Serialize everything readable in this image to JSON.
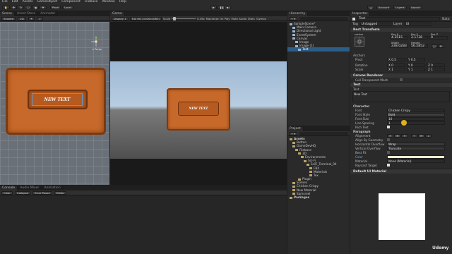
{
  "menu": [
    "File",
    "Edit",
    "Assets",
    "GameObject",
    "Component",
    "Filebase",
    "Window",
    "Help"
  ],
  "top_right": {
    "account": "Account",
    "layers": "Layers",
    "layout": "Layout"
  },
  "scene_tabs": [
    {
      "label": "Scene"
    },
    {
      "label": "Asset Store"
    },
    {
      "label": "Animator"
    }
  ],
  "scene_toolbar": {
    "shading": "Shaded",
    "mode_2d": "2D"
  },
  "game_tab": {
    "label": "Game"
  },
  "game_toolbar": {
    "display": "Display 1",
    "resolution": "Full HD (1920x1080)",
    "scale_label": "Scale",
    "scale_value": "0.49x",
    "maximize": "Maximize On Play",
    "mute": "Mute Audio",
    "stats": "Stats",
    "gizmos": "Gizmos"
  },
  "gizmo_label": "< Persp",
  "scene_button_text": "NEW TEXT",
  "game_button_text": "NEW TEXT",
  "hierarchy": {
    "tab": "Hierarchy",
    "items": [
      {
        "label": "SampleScene*",
        "depth": 0,
        "selected": false
      },
      {
        "label": "Main Camera",
        "depth": 1,
        "selected": false
      },
      {
        "label": "Directional Light",
        "depth": 1,
        "selected": false
      },
      {
        "label": "EventSystem",
        "depth": 1,
        "selected": false
      },
      {
        "label": "Canvas",
        "depth": 1,
        "selected": false
      },
      {
        "label": "Image",
        "depth": 2,
        "selected": false
      },
      {
        "label": "Image (1)",
        "depth": 2,
        "selected": false
      },
      {
        "label": "Text",
        "depth": 3,
        "selected": true
      }
    ]
  },
  "project": {
    "tab": "Project",
    "items": [
      {
        "label": "Assets",
        "depth": 0,
        "bold": true
      },
      {
        "label": "Button",
        "depth": 1
      },
      {
        "label": "GameDevHQ",
        "depth": 1
      },
      {
        "label": "Filebase",
        "depth": 2
      },
      {
        "label": "3D",
        "depth": 3
      },
      {
        "label": "Environments",
        "depth": 4
      },
      {
        "label": "Sci-Fi",
        "depth": 5
      },
      {
        "label": "SciFi_Terminal_04",
        "depth": 6
      },
      {
        "label": "FBX",
        "depth": 7
      },
      {
        "label": "Materials",
        "depth": 7
      },
      {
        "label": "Tex",
        "depth": 7
      },
      {
        "label": "Plugin",
        "depth": 3
      },
      {
        "label": "Scenes",
        "depth": 1
      },
      {
        "label": "Chicken Crispy",
        "depth": 1
      },
      {
        "label": "New Material",
        "depth": 1
      },
      {
        "label": "Samsreel",
        "depth": 1
      },
      {
        "label": "Packages",
        "depth": 0,
        "bold": true
      }
    ]
  },
  "console": {
    "tabs": [
      "Console",
      "Audio Mixer",
      "Animation"
    ],
    "buttons": [
      "Clear",
      "Collapse",
      "Error Pause",
      "Editor"
    ]
  },
  "inspector": {
    "tab": "Inspector",
    "object_name": "Text",
    "static_label": "Static",
    "tag_label": "Tag",
    "tag_value": "Untagged",
    "layer_label": "Layer",
    "layer_value": "UI",
    "rect_transform": "Rect Transform",
    "anchor_label": "center",
    "pos_headers": [
      "Pos X",
      "Pos Y",
      "Pos Z"
    ],
    "pos_values": [
      "4.3515",
      "2.1738",
      "0"
    ],
    "size_headers": [
      "Width",
      "Height"
    ],
    "size_values": [
      "238.0283",
      "56.2852"
    ],
    "anchors": "Anchors",
    "pivot_label": "Pivot",
    "pivot_x": "X 0.5",
    "pivot_y": "Y 0.5",
    "rotation_label": "Rotation",
    "rotation": [
      "X 0",
      "Y 0",
      "Z 0"
    ],
    "scale_label": "Scale",
    "scale": [
      "X 1",
      "Y 1",
      "Z 1"
    ],
    "canvas_renderer": "Canvas Renderer",
    "cull_label": "Cull Transparent Mesh",
    "text_component": "Text",
    "text_label": "Text",
    "text_value": "New Text",
    "character": "Character",
    "font_label": "Font",
    "font_value": "Chicken Crispy",
    "font_style_label": "Font Style",
    "font_style_value": "Bold",
    "font_size_label": "Font Size",
    "font_size_value": "16",
    "line_spacing_label": "Line Spacing",
    "line_spacing_value": "1",
    "rich_text_label": "Rich Text",
    "paragraph": "Paragraph",
    "alignment_label": "Alignment",
    "align_geometry_label": "Align By Geometry",
    "h_overflow_label": "Horizontal Overflow",
    "h_overflow_value": "Wrap",
    "v_overflow_label": "Vertical Overflow",
    "v_overflow_value": "Truncate",
    "best_fit_label": "Best Fit",
    "color_label": "Color",
    "material_label": "Material",
    "material_value": "None (Material)",
    "raycast_label": "Raycast Target",
    "default_material": "Default UI Material"
  },
  "colors": {
    "accent": "#2c5d87",
    "orange": "#d27a34",
    "highlight": "#f0c020"
  },
  "watermark": "Udemy"
}
